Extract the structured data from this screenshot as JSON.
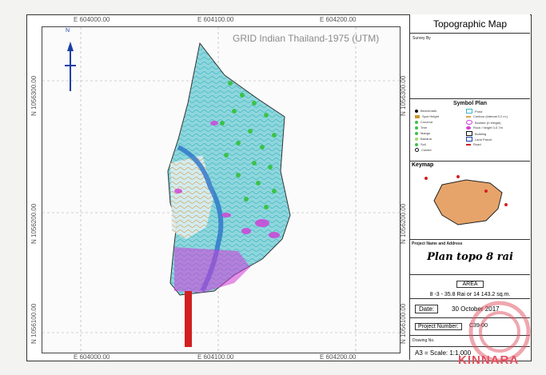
{
  "map": {
    "grid_title": "GRID  Indian Thailand-1975 (UTM)",
    "top_coords": [
      "E 604000.00",
      "E 604100.00",
      "E 604200.00"
    ],
    "bottom_coords": [
      "E 604000.00",
      "E 604100.00",
      "E 604200.00"
    ],
    "left_coords": [
      "N 1056300.00",
      "N 1056200.00",
      "N 1056100.00"
    ],
    "right_coords": [
      "N 1056300.00",
      "N 1056200.00",
      "N 1056100.00"
    ],
    "north_label": "N"
  },
  "panel": {
    "title": "Topographic Map",
    "survey_by": "Survey By",
    "symbol_plan_title": "Symbol Plan",
    "legend_left": [
      "Benchmark",
      "Spot Height",
      "Coconut",
      "Tree",
      "Mango",
      "Banana",
      "Soil",
      "Culvert"
    ],
    "legend_right": [
      "Pond",
      "Contour (interval 0.2 m.)",
      "Boulder (h.Height)",
      "Rock / height 0-0.7m",
      "Building",
      "Land Parcel",
      "Road"
    ],
    "keymap_title": "Keymap",
    "project_name_label": "Project Name and Address",
    "plan_name": "Plan topo  8 rai",
    "area_label": "AREA",
    "area_value": "8 -3 - 35.8  Rai  or  14 143.2 sq.m.",
    "date_label": "Date:",
    "date_value": "30  October  2017",
    "project_number_label": "Project Number:",
    "project_number_value": "C39-00",
    "drawing_label": "Drawing No.",
    "scale": "A3 = Scale: 1:1,000"
  },
  "brand": "KINNARA",
  "colors": {
    "contour_teal": "#3bb8c4",
    "contour_orange": "#e8a04a",
    "tree_green": "#3cc24a",
    "rock_magenta": "#d23bd8",
    "road_red": "#d22020",
    "stream_blue": "#2a73c9",
    "keymap_orange": "#e6a46b"
  }
}
